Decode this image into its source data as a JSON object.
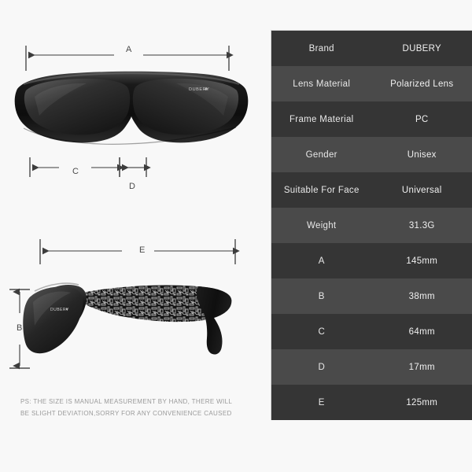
{
  "background_color": "#f8f8f8",
  "panels": {
    "illustration": {
      "name": "product-dimension-diagram",
      "views": [
        {
          "id": "front-view",
          "label": "Front view of polarized sport sunglasses",
          "brand_mark": "DUBERY"
        },
        {
          "id": "side-view",
          "label": "Side view of polarized sport sunglasses with patterned temple arm",
          "brand_mark": "DUBERY"
        }
      ],
      "measurement_markers": [
        {
          "id": "A",
          "label": "A",
          "orientation": "horizontal",
          "view": "front-view",
          "describes": "total frame width"
        },
        {
          "id": "C",
          "label": "C",
          "orientation": "horizontal",
          "view": "front-view",
          "describes": "lens width"
        },
        {
          "id": "D",
          "label": "D",
          "orientation": "horizontal",
          "view": "front-view",
          "describes": "bridge width"
        },
        {
          "id": "E",
          "label": "E",
          "orientation": "horizontal",
          "view": "side-view",
          "describes": "temple arm length"
        },
        {
          "id": "B",
          "label": "B",
          "orientation": "vertical",
          "view": "side-view",
          "describes": "lens height"
        }
      ],
      "disclaimer": {
        "line1": "PS: THE SIZE IS MANUAL MEASUREMENT BY HAND, THERE WILL",
        "line2": "BE SLIGHT DEVIATION,SORRY FOR ANY CONVENIENCE CAUSED"
      }
    }
  },
  "spec_table": {
    "name": "product-specification-table",
    "row_color_odd": "#353535",
    "row_color_even": "#4a4a4a",
    "text_color": "#e8e8e8",
    "rows": [
      {
        "key": "Brand",
        "value": "DUBERY"
      },
      {
        "key": "Lens Material",
        "value": "Polarized Lens"
      },
      {
        "key": "Frame Material",
        "value": "PC"
      },
      {
        "key": "Gender",
        "value": "Unisex"
      },
      {
        "key": "Suitable For Face",
        "value": "Universal"
      },
      {
        "key": "Weight",
        "value": "31.3G"
      },
      {
        "key": "A",
        "value": "145mm"
      },
      {
        "key": "B",
        "value": "38mm"
      },
      {
        "key": "C",
        "value": "64mm"
      },
      {
        "key": "D",
        "value": "17mm"
      },
      {
        "key": "E",
        "value": "125mm"
      }
    ]
  }
}
